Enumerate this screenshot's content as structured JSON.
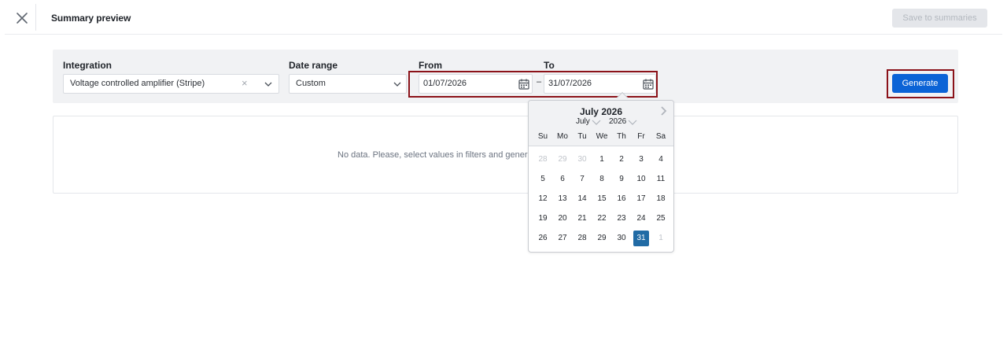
{
  "header": {
    "title": "Summary preview",
    "save_label": "Save to summaries"
  },
  "filters": {
    "integration": {
      "label": "Integration",
      "value": "Voltage controlled amplifier (Stripe)"
    },
    "date_range": {
      "label": "Date range",
      "value": "Custom"
    },
    "from": {
      "label": "From",
      "value": "01/07/2026"
    },
    "to": {
      "label": "To",
      "value": "31/07/2026"
    },
    "dash": "–",
    "generate_label": "Generate"
  },
  "empty_state": {
    "text": "No data. Please, select values in filters and generat"
  },
  "calendar": {
    "title": "July 2026",
    "month_select": "July",
    "year_select": "2026",
    "weekdays": [
      "Su",
      "Mo",
      "Tu",
      "We",
      "Th",
      "Fr",
      "Sa"
    ],
    "weeks": [
      [
        "28",
        "29",
        "30",
        "1",
        "2",
        "3",
        "4"
      ],
      [
        "5",
        "6",
        "7",
        "8",
        "9",
        "10",
        "11"
      ],
      [
        "12",
        "13",
        "14",
        "15",
        "16",
        "17",
        "18"
      ],
      [
        "19",
        "20",
        "21",
        "22",
        "23",
        "24",
        "25"
      ],
      [
        "26",
        "27",
        "28",
        "29",
        "30",
        "31",
        "1"
      ]
    ],
    "selected_day": "31"
  },
  "colors": {
    "primary": "#0b63d6",
    "selected_day": "#216ba5",
    "highlight_border": "#8b1219"
  }
}
